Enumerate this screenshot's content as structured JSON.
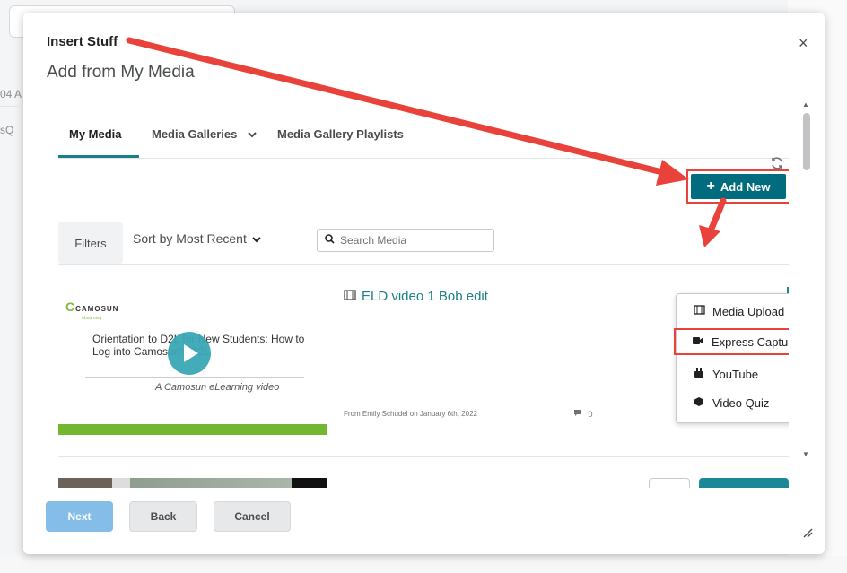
{
  "dialog": {
    "title": "Insert Stuff",
    "subtitle": "Add from My Media",
    "close_glyph": "×"
  },
  "tabs": [
    {
      "label": "My Media",
      "active": true
    },
    {
      "label": "Media Galleries",
      "has_chevron": true
    },
    {
      "label": "Media Gallery Playlists"
    }
  ],
  "icons": {
    "refresh": "refresh-icon",
    "chevron": "chevron-down-icon",
    "search": "search-icon",
    "film": "film-icon",
    "comment": "comment-icon"
  },
  "toolbar": {
    "add_new_label": "Add New",
    "filters_label": "Filters",
    "sort_label": "Sort by Most Recent",
    "search_placeholder": "Search Media"
  },
  "add_menu": {
    "items": [
      {
        "label": "Media Upload",
        "icon": "film-icon"
      },
      {
        "label": "Express Capture",
        "icon": "video-camera-icon",
        "highlighted": true
      },
      {
        "label": "YouTube",
        "icon": "youtube-icon"
      },
      {
        "label": "Video Quiz",
        "icon": "cube-icon"
      }
    ]
  },
  "media_items": [
    {
      "title": "ELD video 1 Bob edit",
      "meta": "From Emily Schudel on January 6th, 2022",
      "comments": "0",
      "thumbnail": {
        "logo": "CAMOSUN",
        "logo_sub": "eLearning",
        "text": "Orientation to D2L for New Students: How to Log into Camosun's D2L",
        "caption": "A Camosun eLearning video"
      }
    }
  ],
  "footer": {
    "next_label": "Next",
    "back_label": "Back",
    "cancel_label": "Cancel"
  },
  "background": {
    "text1": "04 A",
    "text2": "sQ"
  },
  "colors": {
    "accent": "#006c7e",
    "link": "#1b7f87",
    "annotation": "#e8423a",
    "primary_disabled": "#84bde8"
  }
}
